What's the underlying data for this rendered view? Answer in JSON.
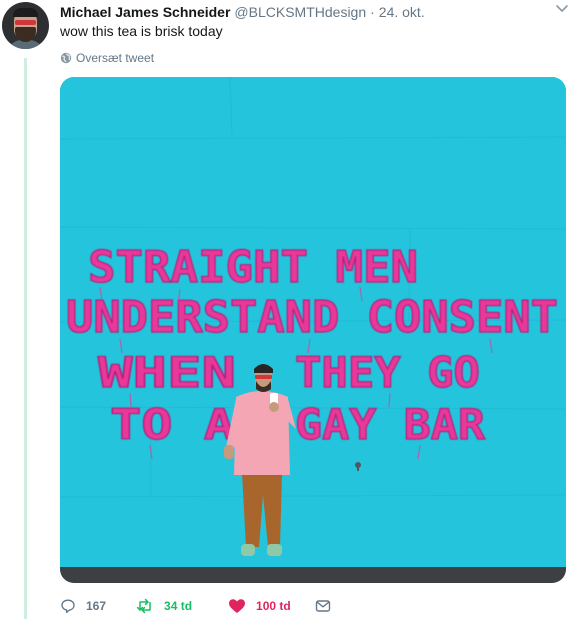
{
  "tweet": {
    "author_name": "Michael James Schneider",
    "author_handle": "@BLCKSMTHdesign",
    "separator": "·",
    "date": "24. okt.",
    "text": "wow this tea is brisk today",
    "translate_label": "Oversæt tweet"
  },
  "image": {
    "line1": "STRAIGHT MEN",
    "line2": "UNDERSTAND CONSENT",
    "line3a": "WHEN",
    "line3b": "THEY GO",
    "line4a": "TO A",
    "line4b": "GAY BAR"
  },
  "actions": {
    "replies": "167",
    "retweets": "34 td",
    "likes": "100 td"
  },
  "colors": {
    "retweet_green": "#17bf63",
    "like_red": "#e0245e",
    "wall_blue": "#23c4dc",
    "balloon_pink": "#e8389a"
  }
}
